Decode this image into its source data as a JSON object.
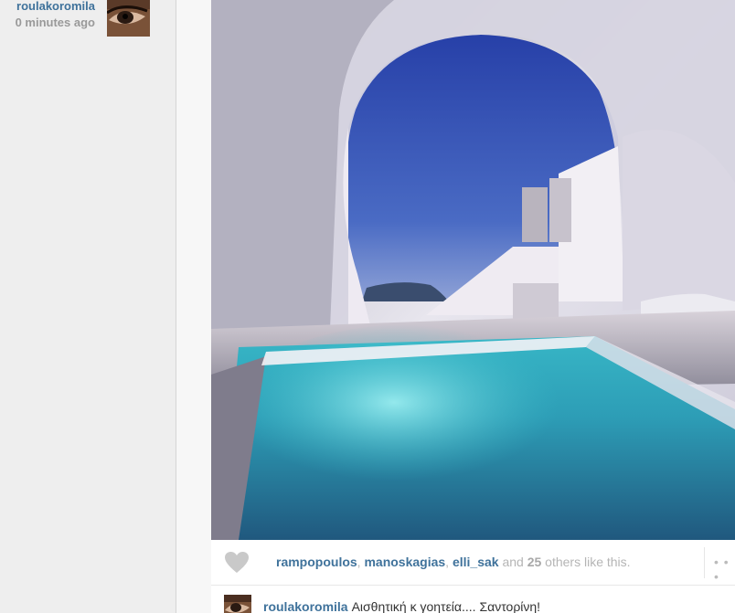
{
  "post": {
    "username": "roulakoromila",
    "time_ago": "0 minutes ago"
  },
  "likes": {
    "likers": [
      "rampopoulos",
      "manoskagias",
      "elli_sak"
    ],
    "sep1": ", ",
    "sep2": ", ",
    "and_text": " and ",
    "others_count": "25",
    "others_text": " others like this.",
    "more": "• • •"
  },
  "comment": {
    "username": "roulakoromila",
    "text": "Αισθητική κ γοητεία.... Σαντορίνη!"
  },
  "icons": {
    "like": "heart-icon",
    "more": "ellipsis-icon"
  },
  "colors": {
    "link": "#3f729b",
    "muted": "#999999",
    "pool": "#3fb4c4",
    "sky": "#2f4fb0"
  }
}
